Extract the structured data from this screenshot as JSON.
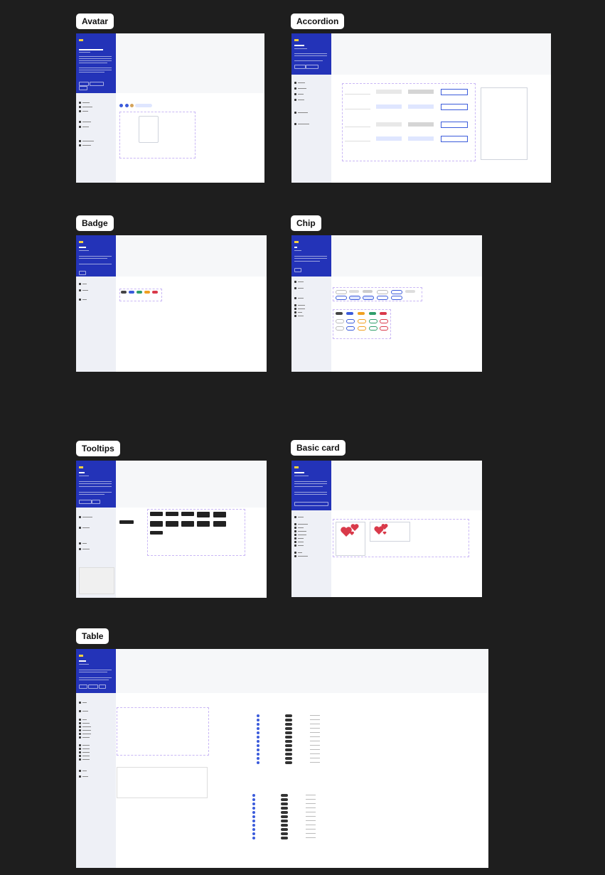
{
  "frames": [
    {
      "id": "avatar",
      "label": "Avatar"
    },
    {
      "id": "accordion",
      "label": "Accordion"
    },
    {
      "id": "badge",
      "label": "Badge"
    },
    {
      "id": "chip",
      "label": "Chip"
    },
    {
      "id": "tooltips",
      "label": "Tooltips"
    },
    {
      "id": "basic-card",
      "label": "Basic card"
    },
    {
      "id": "table",
      "label": "Table"
    }
  ],
  "colors": {
    "canvas": "#1e1e1e",
    "hero_blue": "#2333b8",
    "sidebar": "#eef0f6",
    "accent_blue": "#3b5bdb",
    "heart_red": "#d93a4a"
  }
}
